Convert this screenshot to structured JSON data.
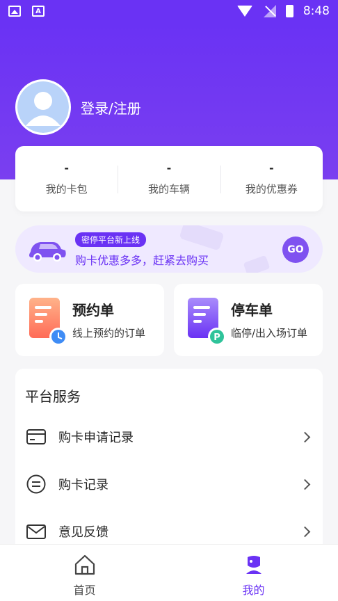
{
  "status_bar": {
    "time": "8:48",
    "left_icons": [
      "image-icon",
      "a-icon"
    ],
    "right_icons": [
      "wifi-icon",
      "signal-icon",
      "battery-icon"
    ]
  },
  "colors": {
    "primary": "#6a32f4",
    "banner_bg": "#efe9ff",
    "stat_divider": "#e8e8ec"
  },
  "profile": {
    "login_label": "登录/注册",
    "avatar": "avatar-icon"
  },
  "stats": [
    {
      "value": "-",
      "label": "我的卡包"
    },
    {
      "value": "-",
      "label": "我的车辆"
    },
    {
      "value": "-",
      "label": "我的优惠券"
    }
  ],
  "promo": {
    "badge": "密停平台新上线",
    "text": "购卡优惠多多，赶紧去购买",
    "go_label": "GO"
  },
  "orders": [
    {
      "title": "预约单",
      "subtitle": "线上预约的订单",
      "icon": "clock-document-icon"
    },
    {
      "title": "停车单",
      "subtitle": "临停/出入场订单",
      "icon": "parking-document-icon"
    }
  ],
  "services": {
    "title": "平台服务",
    "items": [
      {
        "label": "购卡申请记录",
        "icon": "card-icon"
      },
      {
        "label": "购卡记录",
        "icon": "list-circle-icon"
      },
      {
        "label": "意见反馈",
        "icon": "mail-icon"
      }
    ]
  },
  "bottom_nav": [
    {
      "label": "首页",
      "icon": "home-icon",
      "active": false
    },
    {
      "label": "我的",
      "icon": "profile-icon",
      "active": true
    }
  ]
}
